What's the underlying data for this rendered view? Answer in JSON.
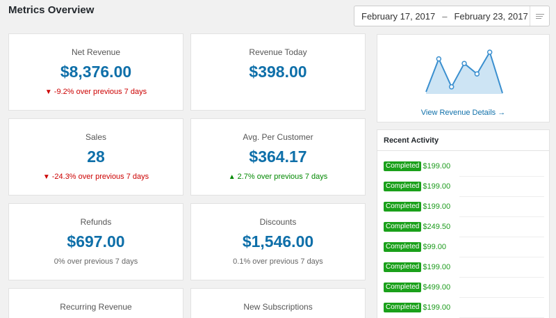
{
  "header": {
    "title": "Metrics Overview",
    "date_start": "February 17, 2017",
    "date_sep": "–",
    "date_end": "February 23, 2017"
  },
  "cards": [
    {
      "label": "Net Revenue",
      "value": "$8,376.00",
      "delta": "-9.2% over previous 7 days",
      "trend": "down"
    },
    {
      "label": "Revenue Today",
      "value": "$398.00",
      "delta": "",
      "trend": "none"
    },
    {
      "label": "Sales",
      "value": "28",
      "delta": "-24.3% over previous 7 days",
      "trend": "down"
    },
    {
      "label": "Avg. Per Customer",
      "value": "$364.17",
      "delta": "2.7% over previous 7 days",
      "trend": "up"
    },
    {
      "label": "Refunds",
      "value": "$697.00",
      "delta": "0% over previous 7 days",
      "trend": "neutral"
    },
    {
      "label": "Discounts",
      "value": "$1,546.00",
      "delta": "0.1% over previous 7 days",
      "trend": "neutral"
    },
    {
      "label": "Recurring Revenue",
      "value": "",
      "delta": "",
      "trend": "none"
    },
    {
      "label": "New Subscriptions",
      "value": "",
      "delta": "",
      "trend": "none"
    }
  ],
  "chart_data": {
    "type": "area",
    "values": [
      0.05,
      0.84,
      0.17,
      0.73,
      0.48,
      1.0,
      0.02
    ],
    "color": "#3a8fcf",
    "fill": "#cde4f4"
  },
  "chart_link": "View Revenue Details →",
  "activity": {
    "title": "Recent Activity",
    "status_color": "#1aa01a",
    "items": [
      {
        "status": "Completed",
        "amount": "$199.00"
      },
      {
        "status": "Completed",
        "amount": "$199.00"
      },
      {
        "status": "Completed",
        "amount": "$199.00"
      },
      {
        "status": "Completed",
        "amount": "$249.50"
      },
      {
        "status": "Completed",
        "amount": "$99.00"
      },
      {
        "status": "Completed",
        "amount": "$199.00"
      },
      {
        "status": "Completed",
        "amount": "$499.00"
      },
      {
        "status": "Completed",
        "amount": "$199.00"
      }
    ]
  }
}
